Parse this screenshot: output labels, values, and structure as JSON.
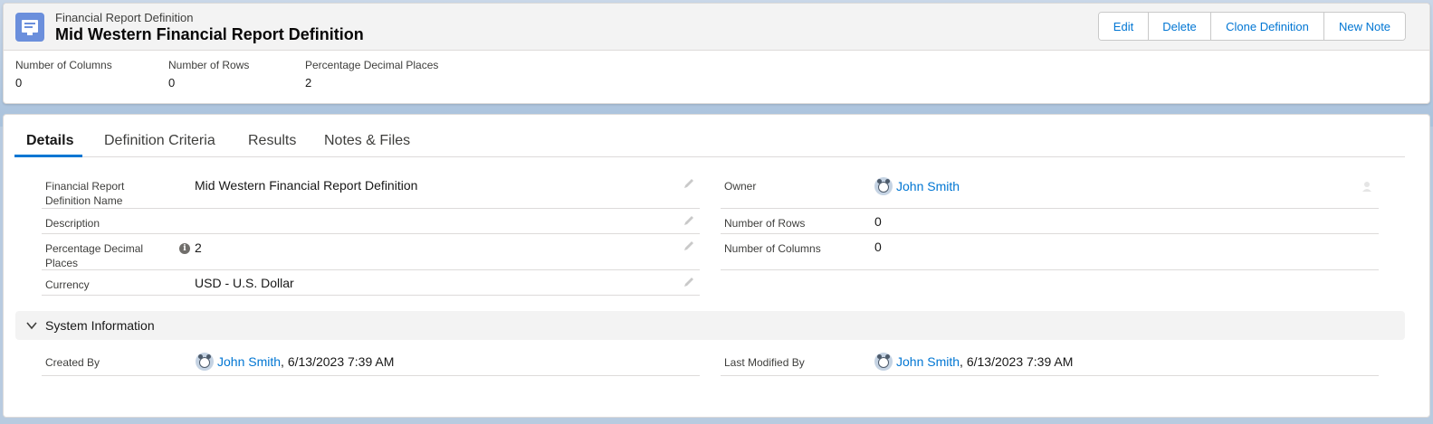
{
  "header": {
    "object_type": "Financial Report Definition",
    "record_title": "Mid Western Financial Report Definition",
    "buttons": [
      "Edit",
      "Delete",
      "Clone Definition",
      "New Note"
    ]
  },
  "highlights": [
    {
      "label": "Number of Columns",
      "value": "0"
    },
    {
      "label": "Number of Rows",
      "value": "0"
    },
    {
      "label": "Percentage Decimal Places",
      "value": "2"
    }
  ],
  "tabs": [
    "Details",
    "Definition Criteria",
    "Results",
    "Notes & Files"
  ],
  "details": {
    "left": [
      {
        "label_line1": "Financial Report",
        "label_line2": "Definition Name",
        "value": "Mid Western Financial Report Definition"
      },
      {
        "label_line1": "Description",
        "label_line2": "",
        "value": ""
      },
      {
        "label_line1": "Percentage Decimal",
        "label_line2": "Places",
        "value": "2"
      },
      {
        "label_line1": "Currency",
        "label_line2": "",
        "value": "USD - U.S. Dollar"
      }
    ],
    "right": [
      {
        "label": "Owner",
        "value": "John Smith"
      },
      {
        "label": "Number of Rows",
        "value": "0"
      },
      {
        "label": "Number of Columns",
        "value": "0"
      }
    ]
  },
  "system_info": {
    "title": "System Information",
    "created_by_label": "Created By",
    "created_by_user": "John Smith",
    "created_by_date": ", 6/13/2023 7:39 AM",
    "modified_by_label": "Last Modified By",
    "modified_by_user": "John Smith",
    "modified_by_date": ", 6/13/2023 7:39 AM"
  },
  "colors": {
    "brand": "#0176d3",
    "object_icon": "#6b8fdc"
  }
}
